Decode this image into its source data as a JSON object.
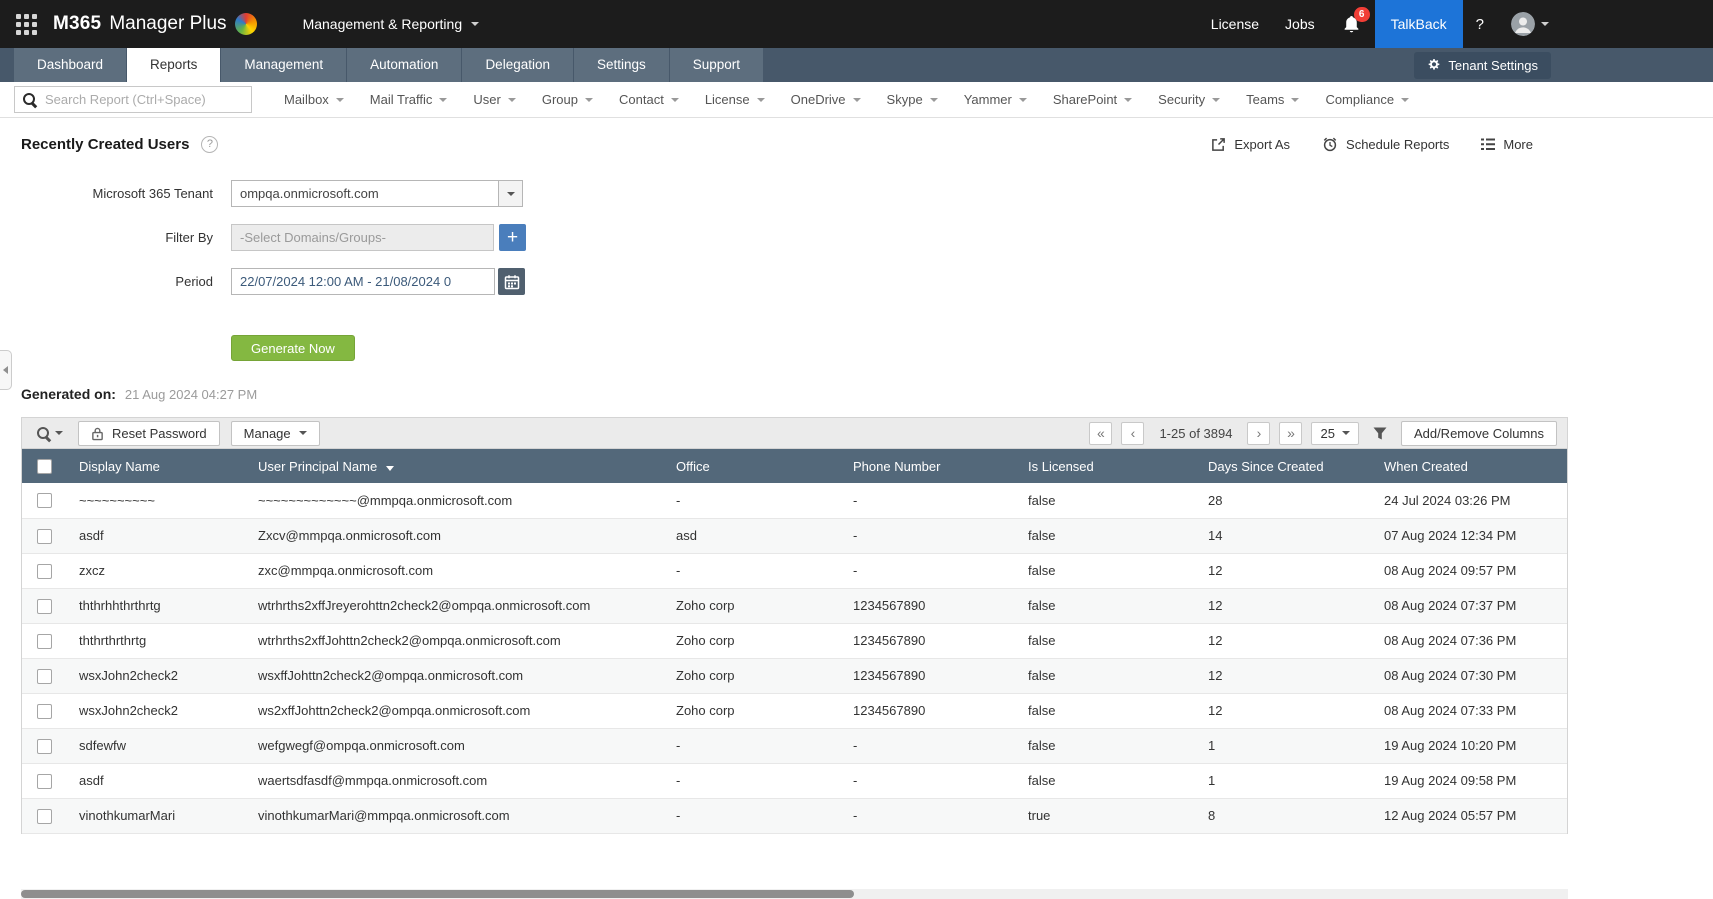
{
  "header": {
    "logo_bold": "M365",
    "logo_rest": "Manager Plus",
    "context_label": "Management & Reporting",
    "license_label": "License",
    "jobs_label": "Jobs",
    "notification_count": "6",
    "talkback_label": "TalkBack",
    "help_glyph": "?"
  },
  "nav": {
    "tabs": [
      "Dashboard",
      "Reports",
      "Management",
      "Automation",
      "Delegation",
      "Settings",
      "Support"
    ],
    "active_tab": "Reports",
    "tenant_settings_label": "Tenant Settings"
  },
  "report_menu": {
    "search_placeholder": "Search Report (Ctrl+Space)",
    "items": [
      "Mailbox",
      "Mail Traffic",
      "User",
      "Group",
      "Contact",
      "License",
      "OneDrive",
      "Skype",
      "Yammer",
      "SharePoint",
      "Security",
      "Teams",
      "Compliance"
    ]
  },
  "page": {
    "title": "Recently Created Users",
    "help_glyph": "?",
    "export_label": "Export As",
    "schedule_label": "Schedule Reports",
    "more_label": "More"
  },
  "form": {
    "tenant_label": "Microsoft 365 Tenant",
    "tenant_value": "ompqa.onmicrosoft.com",
    "filter_label": "Filter By",
    "filter_placeholder": "-Select Domains/Groups-",
    "add_filter_glyph": "+",
    "period_label": "Period",
    "period_value": "22/07/2024 12:00 AM - 21/08/2024 0",
    "generate_label": "Generate Now"
  },
  "generated": {
    "label": "Generated on:",
    "value": "21 Aug 2024 04:27 PM"
  },
  "toolbar": {
    "reset_password_label": "Reset Password",
    "manage_label": "Manage",
    "pager": {
      "first": "«",
      "prev": "‹",
      "next": "›",
      "last": "»"
    },
    "page_info": "1-25 of 3894",
    "page_size": "25",
    "add_remove_label": "Add/Remove Columns"
  },
  "table": {
    "columns": [
      "Display Name",
      "User Principal Name",
      "Office",
      "Phone Number",
      "Is Licensed",
      "Days Since Created",
      "When Created"
    ],
    "sorted_column": "User Principal Name",
    "rows": [
      [
        "~~~~~~~~~~",
        "~~~~~~~~~~~~~@mmpqa.onmicrosoft.com",
        "-",
        "-",
        "false",
        "28",
        "24 Jul 2024 03:26 PM"
      ],
      [
        "asdf",
        "Zxcv@mmpqa.onmicrosoft.com",
        "asd",
        "-",
        "false",
        "14",
        "07 Aug 2024 12:34 PM"
      ],
      [
        "zxcz",
        "zxc@mmpqa.onmicrosoft.com",
        "-",
        "-",
        "false",
        "12",
        "08 Aug 2024 09:57 PM"
      ],
      [
        "ththrhhthrthrtg",
        "wtrhrths2xffJreyerohttn2check2@ompqa.onmicrosoft.com",
        "Zoho corp",
        "1234567890",
        "false",
        "12",
        "08 Aug 2024 07:37 PM"
      ],
      [
        "ththrthrthrtg",
        "wtrhrths2xffJohttn2check2@ompqa.onmicrosoft.com",
        "Zoho corp",
        "1234567890",
        "false",
        "12",
        "08 Aug 2024 07:36 PM"
      ],
      [
        "wsxJohn2check2",
        "wsxffJohttn2check2@ompqa.onmicrosoft.com",
        "Zoho corp",
        "1234567890",
        "false",
        "12",
        "08 Aug 2024 07:30 PM"
      ],
      [
        "wsxJohn2check2",
        "ws2xffJohttn2check2@ompqa.onmicrosoft.com",
        "Zoho corp",
        "1234567890",
        "false",
        "12",
        "08 Aug 2024 07:33 PM"
      ],
      [
        "sdfewfw",
        "wefgwegf@ompqa.onmicrosoft.com",
        "-",
        "-",
        "false",
        "1",
        "19 Aug 2024 10:20 PM"
      ],
      [
        "asdf",
        "waertsdfasdf@mmpqa.onmicrosoft.com",
        "-",
        "-",
        "false",
        "1",
        "19 Aug 2024 09:58 PM"
      ],
      [
        "vinothkumarMari",
        "vinothkumarMari@mmpqa.onmicrosoft.com",
        "-",
        "-",
        "true",
        "8",
        "12 Aug 2024 05:57 PM"
      ]
    ]
  },
  "colors": {
    "header_bg": "#1c1c1c",
    "accent_blue": "#1d74d8",
    "badge_red": "#f23e36",
    "generate_green": "#84b841",
    "table_header_bg": "#53687a"
  }
}
